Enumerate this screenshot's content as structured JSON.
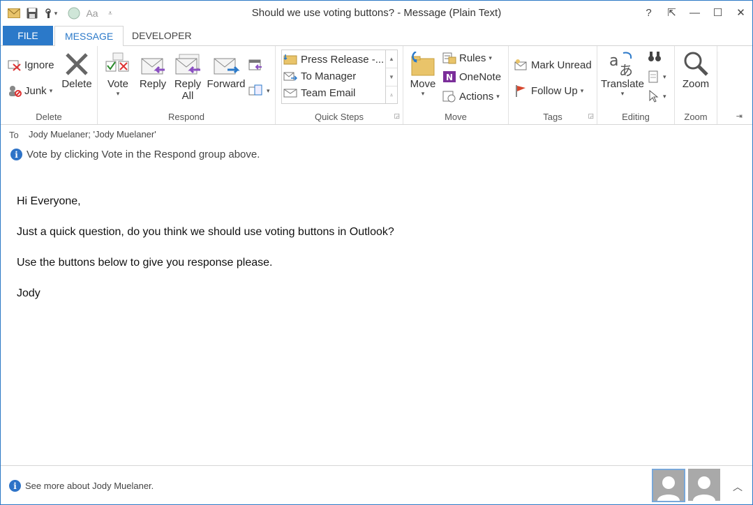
{
  "window": {
    "title": "Should we use voting buttons? - Message (Plain Text)",
    "controls": [
      "?",
      "⇱",
      "—",
      "☐",
      "✕"
    ]
  },
  "qat": {
    "font_label": "Aa"
  },
  "tabs": [
    {
      "label": "FILE"
    },
    {
      "label": "MESSAGE"
    },
    {
      "label": "DEVELOPER"
    }
  ],
  "ribbon": {
    "delete": {
      "label": "Delete",
      "ignore": "Ignore",
      "junk": "Junk",
      "delete": "Delete"
    },
    "respond": {
      "label": "Respond",
      "vote": "Vote",
      "reply": "Reply",
      "reply_all_1": "Reply",
      "reply_all_2": "All",
      "forward": "Forward"
    },
    "quick_steps": {
      "label": "Quick Steps",
      "items": [
        "Press Release -...",
        "To Manager",
        "Team Email"
      ]
    },
    "move": {
      "label": "Move",
      "move": "Move",
      "rules": "Rules",
      "onenote": "OneNote",
      "actions": "Actions"
    },
    "tags": {
      "label": "Tags",
      "mark_unread": "Mark Unread",
      "follow_up": "Follow Up"
    },
    "editing": {
      "label": "Editing",
      "translate": "Translate"
    },
    "zoom": {
      "label": "Zoom",
      "zoom": "Zoom"
    }
  },
  "header": {
    "to_label": "To",
    "to_value": "Jody Muelaner; 'Jody Muelaner'",
    "info": "Vote by clicking Vote in the Respond group above."
  },
  "body": {
    "lines": [
      "Hi Everyone,",
      "Just a quick question, do you think we should use voting buttons in Outlook?",
      "Use the buttons below to give you response please.",
      "Jody"
    ]
  },
  "footer": {
    "info": "See more about Jody Muelaner."
  },
  "colors": {
    "accent": "#2b79c9",
    "info_icon": "#2e73c7"
  }
}
